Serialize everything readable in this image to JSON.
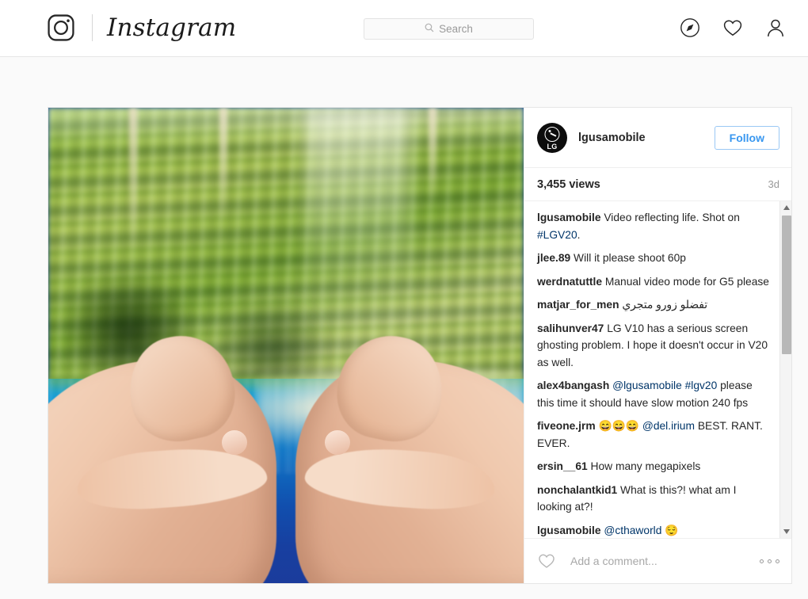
{
  "navbar": {
    "brand": "Instagram",
    "logo_icon": "instagram-camera-icon",
    "search": {
      "placeholder": "Search",
      "value": "",
      "icon": "search-icon"
    },
    "icons": [
      {
        "name": "explore-compass-icon",
        "label": "Explore"
      },
      {
        "name": "activity-heart-icon",
        "label": "Activity"
      },
      {
        "name": "profile-person-icon",
        "label": "Profile"
      }
    ]
  },
  "post": {
    "author": "lgusamobile",
    "avatar_icon": "lg-logo-avatar",
    "avatar_text": "LG",
    "follow_label": "Follow",
    "views": "3,455 views",
    "timestamp": "3d",
    "media": {
      "type": "video",
      "alt": "Two hands framing a reflection on blue water with blurred green trees"
    },
    "comments": [
      {
        "user": "lgusamobile",
        "parts": [
          {
            "type": "text",
            "value": "Video reflecting life. Shot on "
          },
          {
            "type": "link",
            "value": "#LGV20"
          },
          {
            "type": "text",
            "value": "."
          }
        ]
      },
      {
        "user": "jlee.89",
        "parts": [
          {
            "type": "text",
            "value": "Will it please shoot 60p"
          }
        ]
      },
      {
        "user": "werdnatuttle",
        "parts": [
          {
            "type": "text",
            "value": "Manual video mode for G5 please"
          }
        ]
      },
      {
        "user": "matjar_for_men",
        "parts": [
          {
            "type": "rtl",
            "value": "تفضلو زورو متجري"
          }
        ]
      },
      {
        "user": "salihunver47",
        "parts": [
          {
            "type": "text",
            "value": "LG V10 has a serious screen ghosting problem. I hope it doesn't occur in V20 as well."
          }
        ]
      },
      {
        "user": "alex4bangash",
        "parts": [
          {
            "type": "link",
            "value": "@lgusamobile"
          },
          {
            "type": "text",
            "value": " "
          },
          {
            "type": "link",
            "value": "#lgv20"
          },
          {
            "type": "text",
            "value": " please this time it should have slow motion 240 fps"
          }
        ]
      },
      {
        "user": "fiveone.jrm",
        "parts": [
          {
            "type": "text",
            "value": "😄😄😄 "
          },
          {
            "type": "link",
            "value": "@del.irium"
          },
          {
            "type": "text",
            "value": " BEST. RANT. EVER."
          }
        ]
      },
      {
        "user": "ersin__61",
        "parts": [
          {
            "type": "text",
            "value": "How many megapixels"
          }
        ]
      },
      {
        "user": "nonchalantkid1",
        "parts": [
          {
            "type": "text",
            "value": "What is this?! what am I looking at?!"
          }
        ]
      },
      {
        "user": "lgusamobile",
        "parts": [
          {
            "type": "link",
            "value": "@cthaworld"
          },
          {
            "type": "text",
            "value": " 😌"
          }
        ]
      }
    ],
    "scrollbar": {
      "up_arrow": "▲",
      "down_arrow": "▼"
    },
    "footer": {
      "like_icon": "heart-icon",
      "comment_placeholder": "Add a comment...",
      "comment_value": "",
      "more_icon": "more-options-icon"
    }
  },
  "colors": {
    "accent": "#3897f0",
    "link": "#003569",
    "text": "#262626",
    "muted": "#999999",
    "page_bg": "#fafafa",
    "border": "#e6e6e6"
  }
}
